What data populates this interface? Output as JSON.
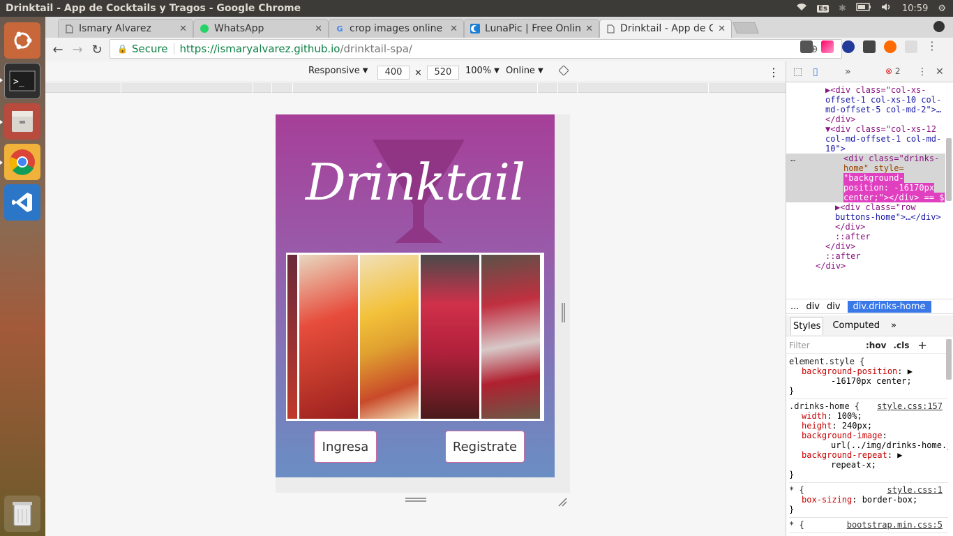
{
  "ubuntu_bar": {
    "window_title": "Drinktail - App de Cocktails y Tragos - Google Chrome",
    "keyboard": "Es",
    "time": "10:59"
  },
  "launcher": {
    "apps": [
      "ubuntu-dash-icon",
      "terminal-icon",
      "files-icon",
      "chrome-icon",
      "vscode-icon",
      "trash-icon"
    ]
  },
  "tabs": [
    {
      "label": "Ismary Alvarez",
      "icon": "page-icon"
    },
    {
      "label": "WhatsApp",
      "icon": "whatsapp-icon"
    },
    {
      "label": "crop images online",
      "icon": "google-icon"
    },
    {
      "label": "LunaPic | Free Onlin",
      "icon": "lunapic-icon"
    },
    {
      "label": "Drinktail - App de C",
      "icon": "page-icon"
    }
  ],
  "omnibox": {
    "secure_label": "Secure",
    "url_host": "https://ismaryalvarez.github.io",
    "url_path": "/drinktail-spa/"
  },
  "devmode": {
    "device": "Responsive",
    "width": "400",
    "times": "×",
    "height": "520",
    "zoom": "100%",
    "network": "Online"
  },
  "app": {
    "brand": "Drinktail",
    "login_button": "Ingresa",
    "register_button": "Registrate",
    "colors": {
      "top": "#a63f98",
      "bottom": "#6a8ec4"
    }
  },
  "devtools": {
    "errors": "2",
    "elements": [
      {
        "indent": 4,
        "text": "▶<div class=\"col-xs-",
        "hl": false
      },
      {
        "indent": 4,
        "text": "offset-1 col-xs-10 col-",
        "hl": false
      },
      {
        "indent": 4,
        "text": "md-offset-5 col-md-2\">…",
        "hl": false
      },
      {
        "indent": 4,
        "text": "</div>",
        "hl": false
      },
      {
        "indent": 4,
        "text": "▼<div class=\"col-xs-12",
        "hl": false
      },
      {
        "indent": 4,
        "text": "col-md-offset-1 col-md-",
        "hl": false
      },
      {
        "indent": 4,
        "text": "10\">",
        "hl": false
      }
    ],
    "selected": [
      "<div class=\"drinks-",
      "home\" style=",
      "\"background-",
      "position: -16170px",
      "center;\"></div> == $"
    ],
    "after_lines": [
      {
        "indent": 5,
        "text": "▶<div class=\"row"
      },
      {
        "indent": 5,
        "text": "buttons-home\">…</div>"
      },
      {
        "indent": 5,
        "text": "</div>"
      },
      {
        "indent": 5,
        "text": "::after"
      },
      {
        "indent": 4,
        "text": "</div>"
      },
      {
        "indent": 4,
        "text": "::after"
      },
      {
        "indent": 3,
        "text": "</div>"
      }
    ],
    "crumbs": [
      "...",
      "div",
      "div",
      "div.drinks-home"
    ],
    "style_tabs": [
      "Styles",
      "Computed"
    ],
    "filter_placeholder": "Filter",
    "hov": ":hov",
    "cls": ".cls",
    "rules": [
      {
        "selector": "element.style {",
        "source": "",
        "props": [
          [
            "background-position",
            "-16170px center;"
          ]
        ]
      },
      {
        "selector": ".drinks-home {",
        "source": "style.css:157",
        "props": [
          [
            "width",
            "100%;"
          ],
          [
            "height",
            "240px;"
          ],
          [
            "background-image",
            "url(../img/drinks-home.jpg);"
          ],
          [
            "background-repeat",
            "repeat-x;"
          ]
        ]
      },
      {
        "selector": "* {",
        "source": "style.css:1",
        "props": [
          [
            "box-sizing",
            "border-box;"
          ]
        ]
      },
      {
        "selector": "* {",
        "source": "bootstrap.min.css:5",
        "props": []
      }
    ]
  }
}
